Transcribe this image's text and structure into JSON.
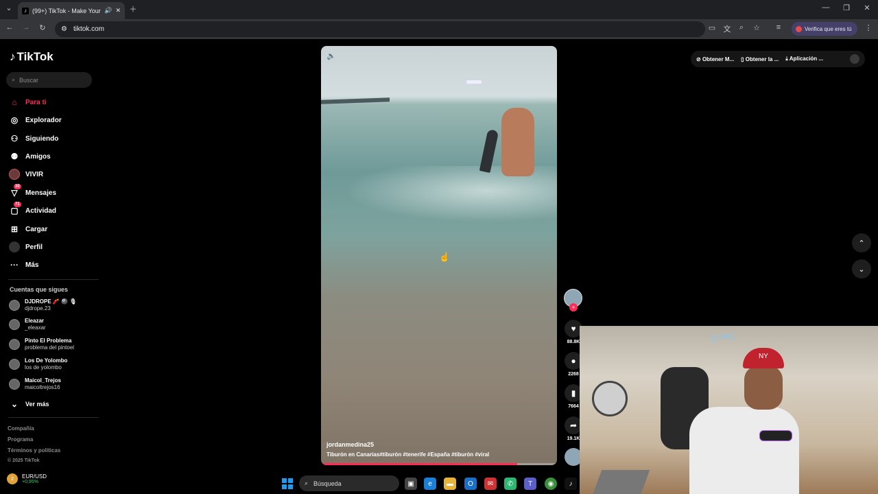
{
  "browser": {
    "tab_title": "(99+) TikTok - Make Your Da",
    "url": "tiktok.com",
    "verify_label": "Verifica que eres tú",
    "window_controls": [
      "minimize",
      "restore",
      "close"
    ]
  },
  "app": {
    "logo": "TikTok",
    "search_placeholder": "Buscar"
  },
  "sidebar": {
    "items": [
      {
        "label": "Para ti",
        "icon": "home-icon",
        "active": true
      },
      {
        "label": "Explorador",
        "icon": "compass-icon"
      },
      {
        "label": "Siguiendo",
        "icon": "following-icon"
      },
      {
        "label": "Amigos",
        "icon": "friends-icon"
      },
      {
        "label": "VIVIR",
        "icon": "live-icon"
      },
      {
        "label": "Mensajes",
        "icon": "message-icon",
        "badge": "30"
      },
      {
        "label": "Actividad",
        "icon": "activity-icon",
        "badge": "71"
      },
      {
        "label": "Cargar",
        "icon": "upload-icon"
      },
      {
        "label": "Perfil",
        "icon": "profile-icon"
      },
      {
        "label": "Más",
        "icon": "more-icon"
      }
    ],
    "following_title": "Cuentas que sigues",
    "accounts": [
      {
        "name": "DJDROPE 🧨 🎱 🎙",
        "username": "djdrope.23"
      },
      {
        "name": "Eleazar",
        "username": "_eleaxar"
      },
      {
        "name": "Pinto El Problema",
        "username": "problema del pintoel"
      },
      {
        "name": "Los De Yolombo",
        "username": "los de yolombo"
      },
      {
        "name": "Maicol_Trejos",
        "username": "maicoltrejos16"
      }
    ],
    "see_more": "Ver más",
    "footer": [
      "Compañía",
      "Programa",
      "Términos y políticas",
      "© 2025 TikTok"
    ]
  },
  "video": {
    "author": "jordanmedina25",
    "caption": "Tiburón en Canarias#tiburón  #tenerife  #España  #tiburón  #viral",
    "progress": 0.83
  },
  "actions": [
    {
      "icon": "heart-icon",
      "count": "88.8K"
    },
    {
      "icon": "comment-icon",
      "count": "2268"
    },
    {
      "icon": "bookmark-icon",
      "count": "7664"
    },
    {
      "icon": "share-icon",
      "count": "19.1K"
    }
  ],
  "topbar": {
    "items": [
      "Obtener M...",
      "Obtener la ...",
      "Aplicación ..."
    ]
  },
  "taskbar": {
    "currency_pair": "EUR/USD",
    "currency_change": "+0,95%",
    "search_label": "Búsqueda",
    "notification_badge": "2"
  },
  "colors": {
    "accent": "#fe2c55",
    "chrome_bg": "#1f2024",
    "toolbar_bg": "#35363a"
  }
}
